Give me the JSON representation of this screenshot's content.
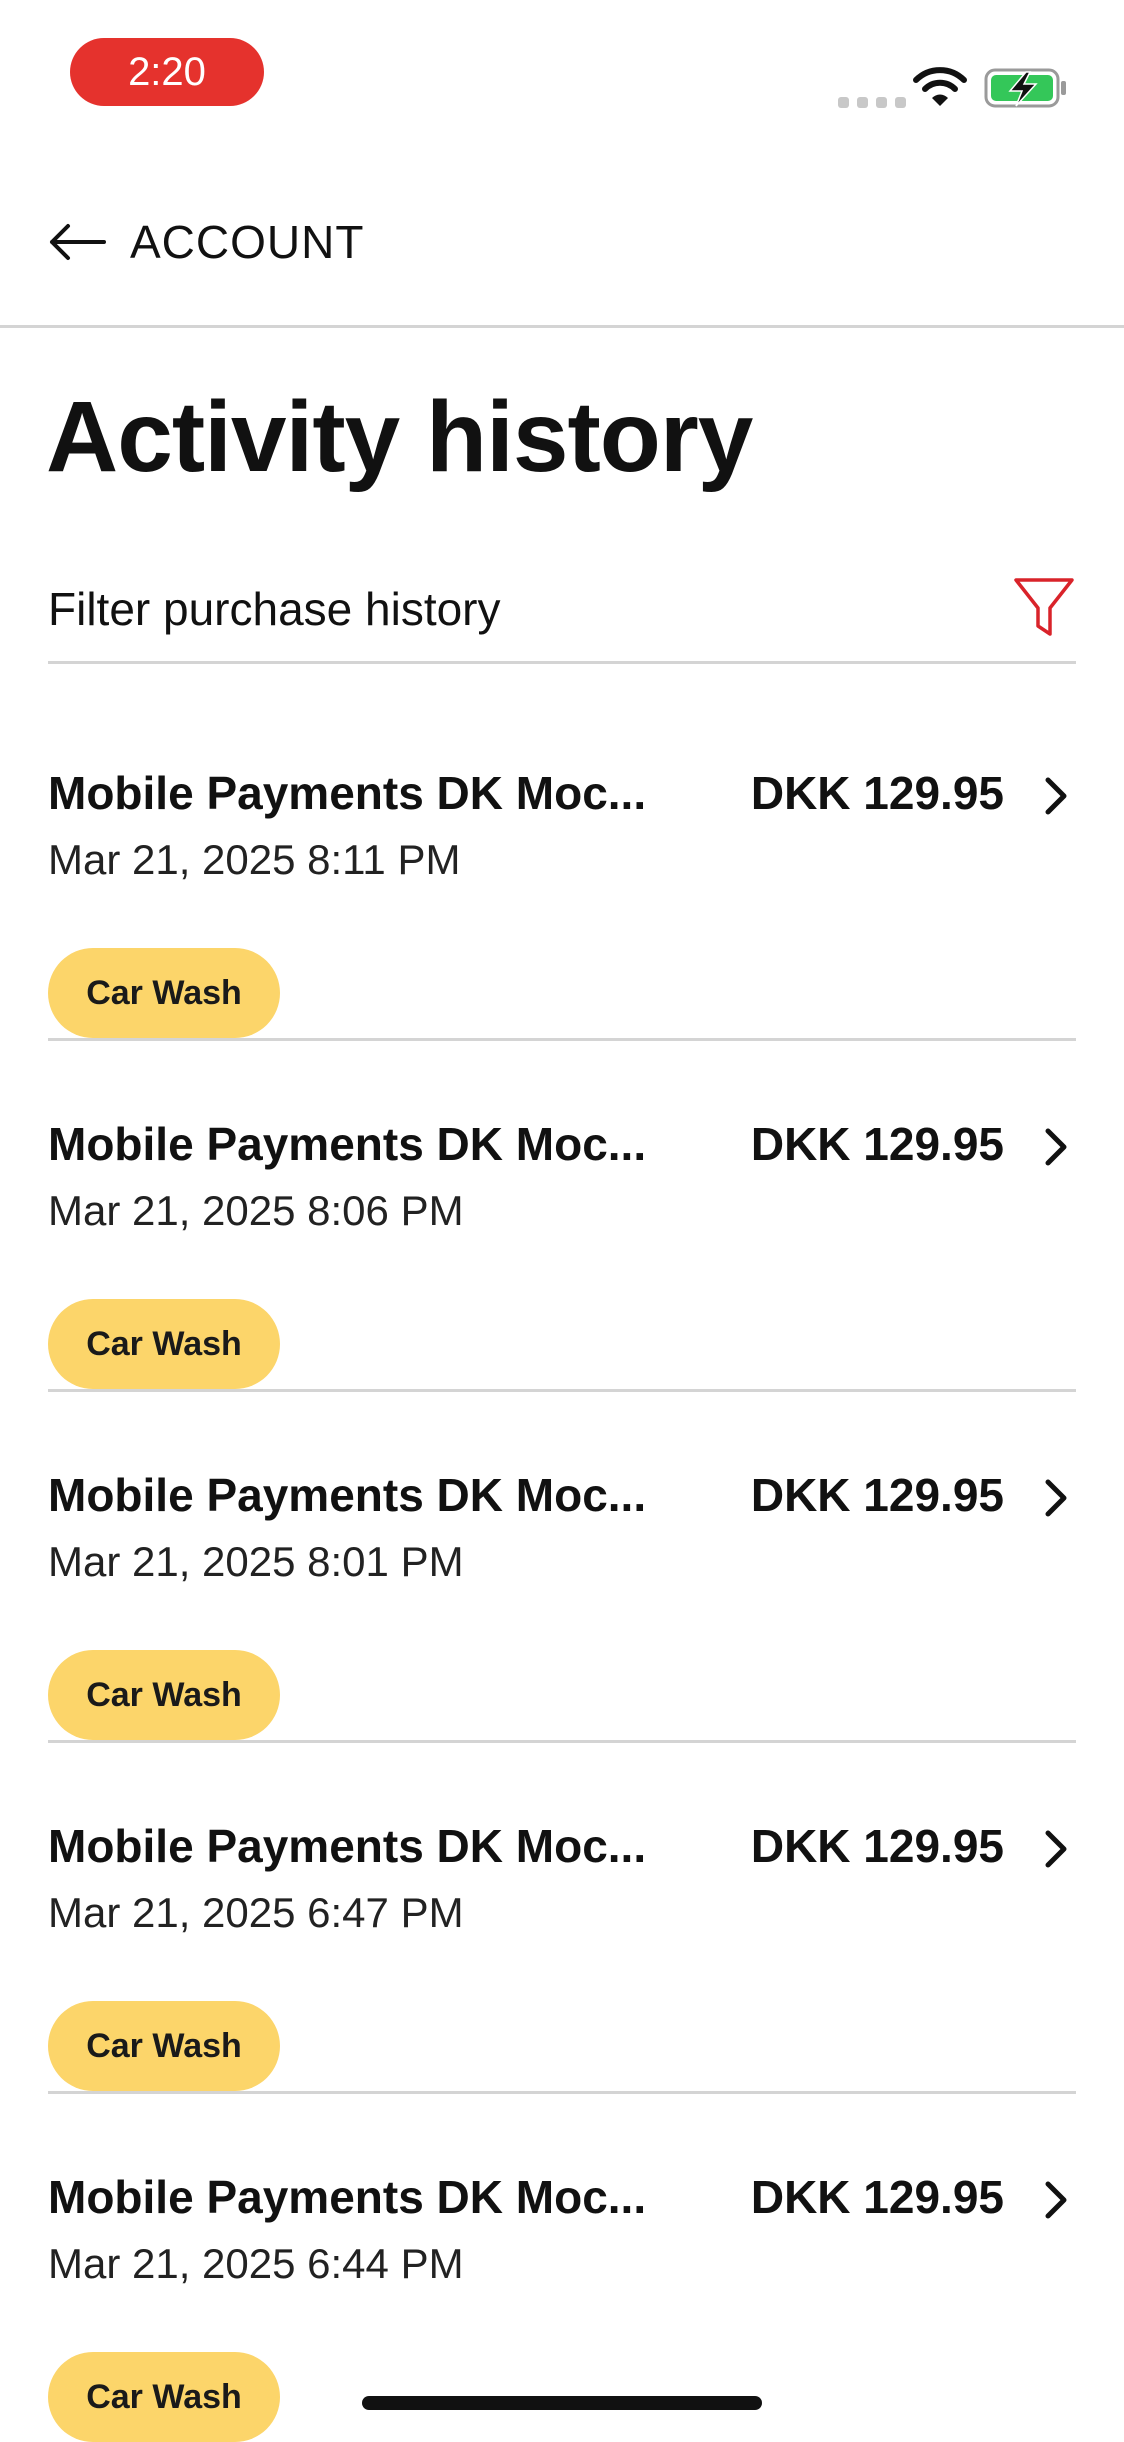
{
  "status_bar": {
    "time": "2:20"
  },
  "nav": {
    "back_label": "ACCOUNT"
  },
  "page": {
    "title": "Activity history"
  },
  "filter": {
    "label": "Filter purchase history"
  },
  "activities": [
    {
      "merchant": "Mobile Payments DK Moc...",
      "amount": "DKK 129.95",
      "date": "Mar 21, 2025 8:11 PM",
      "tag": "Car Wash"
    },
    {
      "merchant": "Mobile Payments DK Moc...",
      "amount": "DKK 129.95",
      "date": "Mar 21, 2025 8:06 PM",
      "tag": "Car Wash"
    },
    {
      "merchant": "Mobile Payments DK Moc...",
      "amount": "DKK 129.95",
      "date": "Mar 21, 2025 8:01 PM",
      "tag": "Car Wash"
    },
    {
      "merchant": "Mobile Payments DK Moc...",
      "amount": "DKK 129.95",
      "date": "Mar 21, 2025 6:47 PM",
      "tag": "Car Wash"
    },
    {
      "merchant": "Mobile Payments DK Moc...",
      "amount": "DKK 129.95",
      "date": "Mar 21, 2025 6:44 PM",
      "tag": "Car Wash"
    }
  ],
  "colors": {
    "time_pill": "#e5322d",
    "tag_background": "#fcd56a",
    "filter_icon": "#d9232a",
    "battery": "#34c759",
    "divider": "#d4d4d4"
  },
  "icons": [
    "signal-icon",
    "wifi-icon",
    "battery-charging-icon",
    "back-arrow-icon",
    "filter-icon",
    "chevron-right-icon"
  ]
}
